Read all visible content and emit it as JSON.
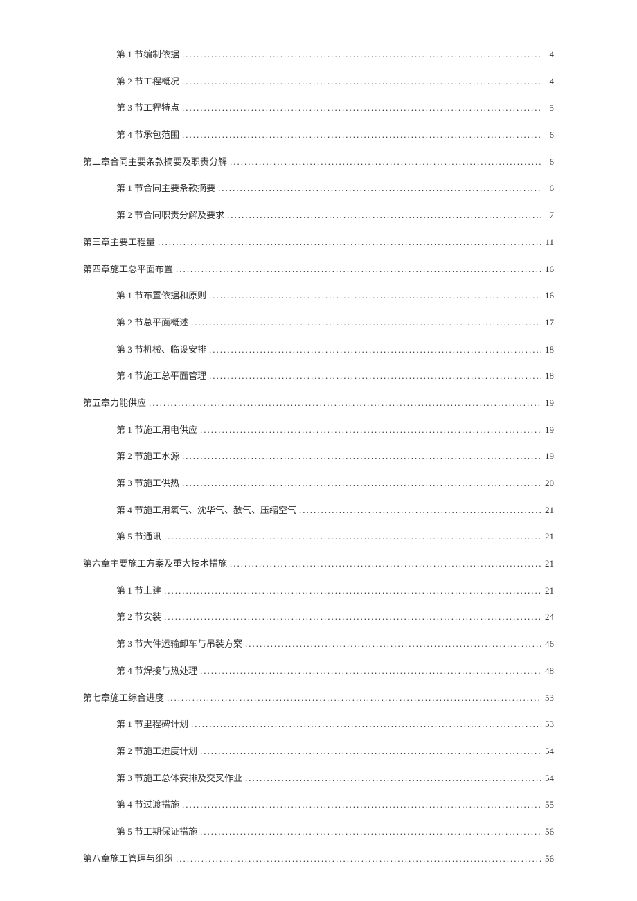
{
  "toc": [
    {
      "level": 2,
      "title": "第 1 节编制依据",
      "page": "4"
    },
    {
      "level": 2,
      "title": "第 2 节工程概况",
      "page": "4"
    },
    {
      "level": 2,
      "title": "第 3 节工程特点",
      "page": "5"
    },
    {
      "level": 2,
      "title": "第 4 节承包范围",
      "page": "6"
    },
    {
      "level": 1,
      "title": "第二章合同主要条款摘要及职责分解",
      "page": "6"
    },
    {
      "level": 2,
      "title": "第 1 节合同主要条款摘要",
      "page": "6"
    },
    {
      "level": 2,
      "title": "第 2 节合同职责分解及要求",
      "page": "7"
    },
    {
      "level": 1,
      "title": "第三章主要工程量",
      "page": "11"
    },
    {
      "level": 1,
      "title": "第四章施工总平面布置",
      "page": "16"
    },
    {
      "level": 2,
      "title": "第 1 节布置依据和原则",
      "page": "16"
    },
    {
      "level": 2,
      "title": "第 2 节总平面概述",
      "page": "17"
    },
    {
      "level": 2,
      "title": "第 3 节机械、临设安排",
      "page": "18"
    },
    {
      "level": 2,
      "title": "第 4 节施工总平面管理",
      "page": "18"
    },
    {
      "level": 1,
      "title": "第五章力能供应",
      "page": "19"
    },
    {
      "level": 2,
      "title": "第 1 节施工用电供应",
      "page": "19"
    },
    {
      "level": 2,
      "title": "第 2 节施工水源",
      "page": "19"
    },
    {
      "level": 2,
      "title": "第 3 节施工供热",
      "page": "20"
    },
    {
      "level": 2,
      "title": "第 4 节施工用氧气、沈华气、赦气、压缩空气",
      "page": "21"
    },
    {
      "level": 2,
      "title": "第 5 节通讯",
      "page": "21"
    },
    {
      "level": 1,
      "title": "第六章主要施工方案及重大技术措施",
      "page": "21"
    },
    {
      "level": 2,
      "title": "第 1 节土建",
      "page": "21"
    },
    {
      "level": 2,
      "title": "第 2 节安装",
      "page": "24"
    },
    {
      "level": 2,
      "title": "第 3 节大件运输卸车与吊装方案",
      "page": "46"
    },
    {
      "level": 2,
      "title": "第 4 节焊接与热处理",
      "page": "48"
    },
    {
      "level": 1,
      "title": "第七章施工综合进度",
      "page": "53"
    },
    {
      "level": 2,
      "title": "第 1 节里程碑计划",
      "page": "53"
    },
    {
      "level": 2,
      "title": "第 2 节施工进度计划",
      "page": "54"
    },
    {
      "level": 2,
      "title": "第 3 节施工总体安排及交叉作业",
      "page": "54"
    },
    {
      "level": 2,
      "title": "第 4 节过渡措施",
      "page": "55"
    },
    {
      "level": 2,
      "title": "第 5 节工期保证措施",
      "page": "56"
    },
    {
      "level": 1,
      "title": "第八章施工管理与组织",
      "page": "56"
    }
  ]
}
